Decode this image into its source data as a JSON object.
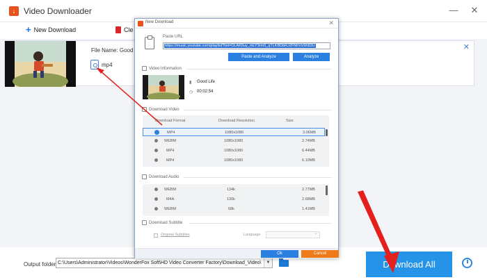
{
  "app": {
    "title": "Video Downloader",
    "logo_glyph": "↓",
    "minimize_glyph": "—",
    "close_glyph": "✕"
  },
  "toolbar": {
    "new_download_label": "New Download",
    "clear_label": "Cle"
  },
  "task": {
    "file_name_label": "File Name: Good L",
    "format": "mp4",
    "close_glyph": "✕"
  },
  "bottom": {
    "output_label": "Output folder:",
    "output_path": "C:\\Users\\Administrator\\Videos\\WonderFox Soft\\HD Video Converter Factory\\Download_Video\\",
    "dropdown_glyph": "▼",
    "download_all_label": "Download All"
  },
  "dialog": {
    "title": "New Download",
    "close_glyph": "✕",
    "paste_url_label": "Paste URL",
    "url_value": "https://music.youtube.com/playlist?list=OLAK5uy_mLY3rm5_qTLKBDbRJ2FNhVsSh83U",
    "paste_analyze_label": "Paste and Analyze",
    "analyze_label": "Analyze",
    "video_info_label": "Video Information",
    "video_title": "Good Life",
    "video_duration": "00:02:54",
    "download_video_label": "Download Video",
    "video_columns": [
      "Download Format",
      "Download Resolution",
      "Size"
    ],
    "video_rows": [
      {
        "format": "MP4",
        "resolution": "1080x1080",
        "size": "3.06MB",
        "selected": true
      },
      {
        "format": "WEBM",
        "resolution": "1080x1080",
        "size": "2.74MB",
        "selected": false
      },
      {
        "format": "MP4",
        "resolution": "1080x1080",
        "size": "6.44MB",
        "selected": false
      },
      {
        "format": "MP4",
        "resolution": "1080x1080",
        "size": "6.10MB",
        "selected": false
      }
    ],
    "download_audio_label": "Download Audio",
    "audio_rows": [
      {
        "format": "WEBM",
        "bitrate": "134k",
        "size": "2.77MB"
      },
      {
        "format": "M4A",
        "bitrate": "130k",
        "size": "2.68MB"
      },
      {
        "format": "WEBM",
        "bitrate": "68k",
        "size": "1.41MB"
      }
    ],
    "download_subtitle_label": "Download Subtitle",
    "original_subtitles_label": "Original Subtitles",
    "language_label": "Language",
    "ok_label": "Ok",
    "cancel_label": "Cancel"
  },
  "colors": {
    "accent_blue": "#2593e8",
    "annotation_red": "#e3201b",
    "cancel_orange": "#ef7a1a"
  }
}
